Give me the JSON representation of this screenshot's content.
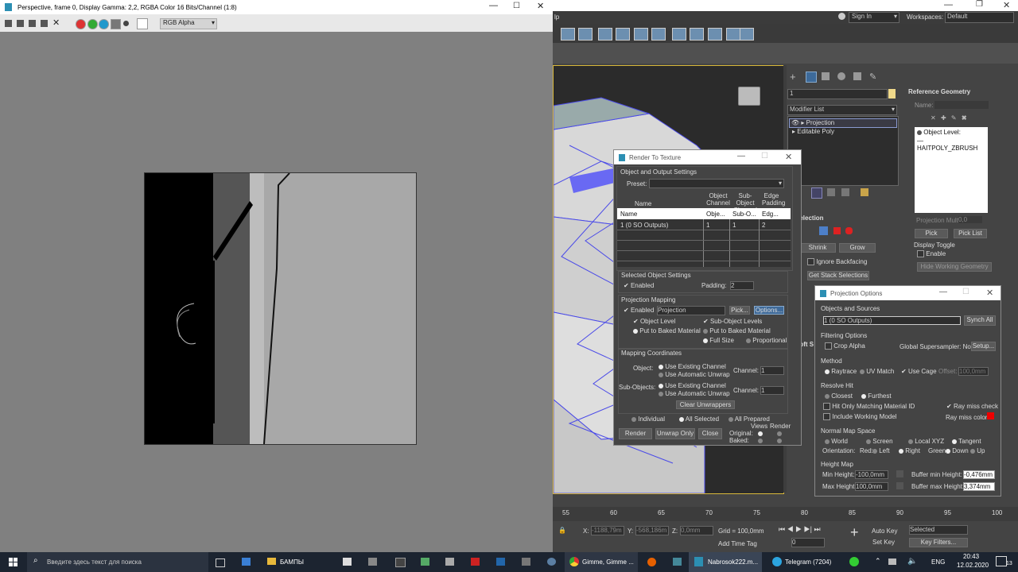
{
  "fb": {
    "title": "Perspective, frame 0, Display Gamma: 2,2, RGBA Color 16 Bits/Channel (1:8)",
    "channel": "RGB Alpha",
    "swatches": [
      "#d33",
      "#3a3",
      "#29c",
      "#777",
      "#fff"
    ]
  },
  "max": {
    "menu_tail": "lp",
    "sign_in": "Sign In",
    "workspaces_label": "Workspaces:",
    "workspace": "Default"
  },
  "cmd": {
    "name_value": "1",
    "modifier_list": "Modifier List",
    "stack": [
      "Projection",
      "Editable Poly"
    ],
    "selection": "Selection",
    "shrink": "Shrink",
    "grow": "Grow",
    "ignore_backfacing": "Ignore Backfacing",
    "get_stack_selections": "Get Stack Selections",
    "soft_s": "Soft S"
  },
  "refgeo": {
    "title": "Reference Geometry",
    "name_label": "Name:",
    "object_level": "Object Level:",
    "object_name": "HAITPOLY_ZBRUSH",
    "proj_mult": "Projection Mult:",
    "proj_mult_val": "0,0",
    "pick": "Pick",
    "pick_list": "Pick List",
    "display_toggle": "Display Toggle",
    "enable": "Enable",
    "hide_working": "Hide Working Geometry"
  },
  "rtt": {
    "title": "Render To Texture",
    "obj_out": "Object and Output Settings",
    "preset": "Preset:",
    "cols": [
      "Name",
      "Object Channel",
      "Sub-Object Channel",
      "Edge Padding"
    ],
    "hdr_row": [
      "Name",
      "Obje...",
      "Sub-O...",
      "Edg..."
    ],
    "row": [
      "1 (0 SO Outputs)",
      "1",
      "1",
      "2"
    ],
    "sel_obj": "Selected Object Settings",
    "enabled": "Enabled",
    "padding": "Padding:",
    "padding_val": "2",
    "proj_map": "Projection Mapping",
    "projection": "Projection",
    "pick": "Pick...",
    "options": "Options...",
    "object_level": "Object Level",
    "sub_object_levels": "Sub-Object Levels",
    "put_baked": "Put to Baked Material",
    "put_baked2": "Put to Baked Material",
    "full_size": "Full Size",
    "proportional": "Proportional",
    "mapping": "Mapping Coordinates",
    "object": "Object:",
    "use_existing": "Use Existing Channel",
    "use_auto": "Use Automatic Unwrap",
    "channel": "Channel:",
    "channel_val": "1",
    "sub_objects": "Sub-Objects:",
    "use_existing2": "Use Existing Channel",
    "use_auto2": "Use Automatic Unwrap",
    "channel2": "Channel:",
    "channel_val2": "1",
    "clear_unwrappers": "Clear Unwrappers",
    "individual": "Individual",
    "all_selected": "All Selected",
    "all_prepared": "All Prepared",
    "render": "Render",
    "unwrap_only": "Unwrap Only",
    "close": "Close",
    "views": "Views",
    "render_col": "Render",
    "original": "Original:",
    "baked": "Baked:"
  },
  "po": {
    "title": "Projection Options",
    "objects_sources": "Objects and Sources",
    "source": "1 (0 SO Outputs)",
    "synch_all": "Synch All",
    "filtering": "Filtering Options",
    "crop_alpha": "Crop Alpha",
    "global_ss": "Global Supersampler: None",
    "setup": "Setup...",
    "method": "Method",
    "raytrace": "Raytrace",
    "uv_match": "UV Match",
    "use_cage": "Use Cage",
    "offset": "Offset:",
    "offset_val": "100,0mm",
    "resolve_hit": "Resolve Hit",
    "closest": "Closest",
    "furthest": "Furthest",
    "hit_only": "Hit Only Matching Material ID",
    "ray_miss_check": "Ray miss check",
    "include_working": "Include Working Model",
    "ray_miss_color": "Ray miss color:",
    "normal_map": "Normal Map Space",
    "world": "World",
    "screen": "Screen",
    "local_xyz": "Local XYZ",
    "tangent": "Tangent",
    "orientation": "Orientation:",
    "red": "Red:",
    "left": "Left",
    "right": "Right",
    "green": "Green:",
    "down": "Down",
    "up": "Up",
    "height_map": "Height Map",
    "min_height": "Min Height:",
    "min_height_val": "-100,0mm",
    "max_height": "Max Height:",
    "max_height_val": "100,0mm",
    "buf_min": "Buffer min Height:",
    "buf_min_val": "-0,476mm",
    "buf_max": "Buffer max Height:",
    "buf_max_val": "3,374mm"
  },
  "status": {
    "ticks": [
      "55",
      "60",
      "65",
      "70",
      "75",
      "80",
      "85",
      "90",
      "95",
      "100"
    ],
    "x_label": "X:",
    "x_val": "-1188,79m",
    "y_label": "Y:",
    "y_val": "-568,186m",
    "z_label": "Z:",
    "z_val": "0,0mm",
    "grid": "Grid = 100,0mm",
    "add_time_tag": "Add Time Tag",
    "frame": "0",
    "auto_key": "Auto Key",
    "selected": "Selected",
    "set_key": "Set Key",
    "key_filters": "Key Filters..."
  },
  "taskbar": {
    "search": "Введите здесь текст для поиска",
    "folder": "БАМПЫ",
    "chrome": "Gimme, Gimme ...",
    "max": "Nabrosok222.m...",
    "telegram": "Telegram (7204)",
    "lang": "ENG",
    "time": "20:43",
    "date": "12.02.2020",
    "notif": "13"
  }
}
